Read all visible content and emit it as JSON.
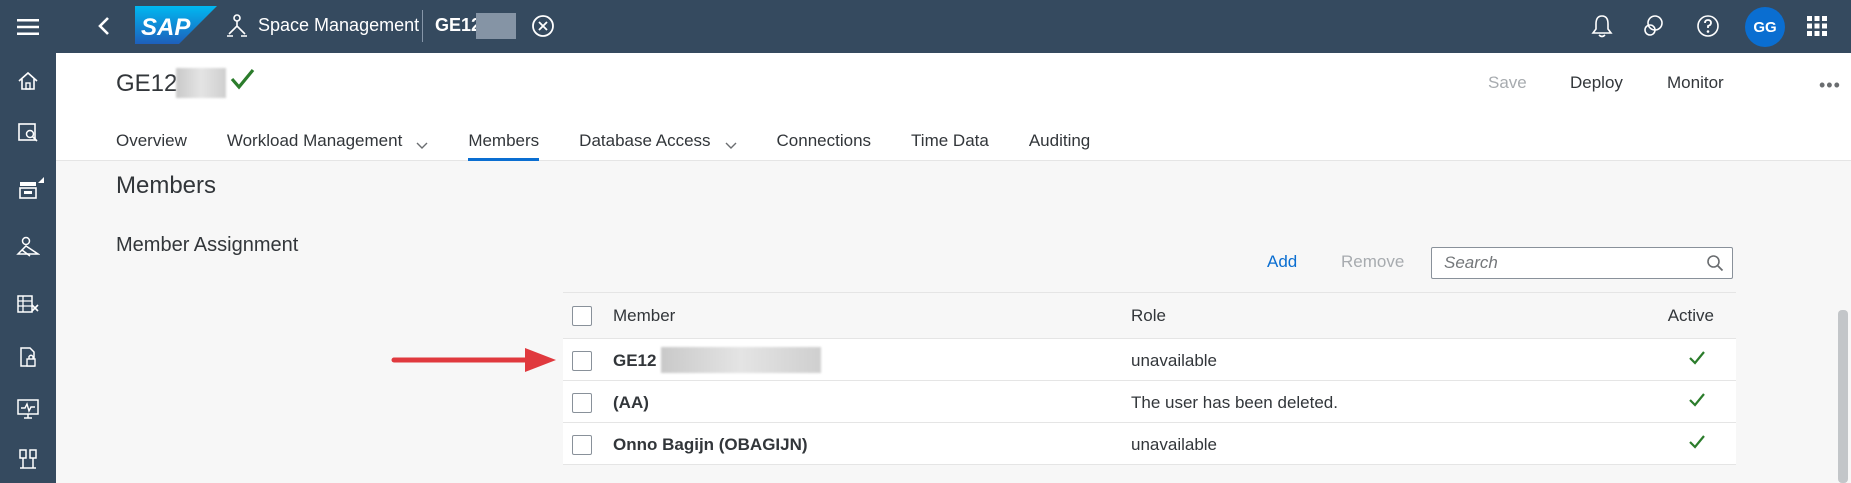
{
  "shell": {
    "app_title": "Space Management",
    "space_id": "GE12",
    "avatar_initials": "GG",
    "brand_color": "#354a5f",
    "accent_color": "#0a6ed1"
  },
  "side_nav": {
    "items": [
      "home-icon",
      "data-builder-icon",
      "catalog-icon",
      "business-builder-icon",
      "data-access-icon",
      "security-icon",
      "system-monitor-icon",
      "configuration-icon"
    ]
  },
  "header": {
    "title": "GE12",
    "actions": {
      "save": "Save",
      "deploy": "Deploy",
      "monitor": "Monitor",
      "more": "•••"
    },
    "tabs": [
      {
        "label": "Overview"
      },
      {
        "label": "Workload Management"
      },
      {
        "label": "Members"
      },
      {
        "label": "Database Access"
      },
      {
        "label": "Connections"
      },
      {
        "label": "Time Data"
      },
      {
        "label": "Auditing"
      }
    ],
    "active_tab": "Members"
  },
  "main": {
    "section_title": "Members",
    "sub_title": "Member Assignment",
    "toolbar": {
      "add": "Add",
      "remove": "Remove",
      "search_placeholder": "Search"
    },
    "table": {
      "columns": [
        "Member",
        "Role",
        "Active"
      ],
      "rows": [
        {
          "member": "GE12",
          "role": "unavailable",
          "active": true
        },
        {
          "member": "(AA)",
          "role": "The user has been deleted.",
          "active": true
        },
        {
          "member": "Onno Bagijn (OBAGIJN)",
          "role": "unavailable",
          "active": true
        }
      ]
    }
  }
}
